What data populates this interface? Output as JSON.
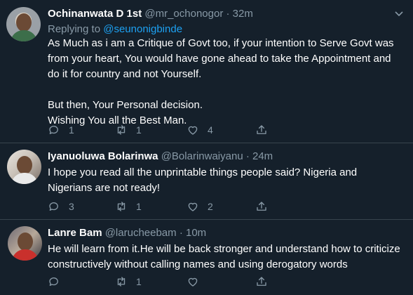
{
  "tweets": [
    {
      "name": "Ochinanwata D 1st",
      "handle": "@mr_ochonogor",
      "dot": "·",
      "time": "32m",
      "replying_prefix": "Replying to ",
      "replying_to": "@seunonigbinde",
      "lines": [
        "As Much as i am a Critique of Govt too, if your intention to Serve Govt was",
        "from your heart, You would have gone ahead to take the Appointment and",
        "do it for country and not Yourself.",
        "",
        "But then, Your Personal decision.",
        "Wishing You all the Best Man."
      ],
      "replies": "1",
      "retweets": "1",
      "likes": "4"
    },
    {
      "name": "Iyanuoluwa Bolarinwa",
      "handle": "@Bolarinwaiyanu",
      "dot": "·",
      "time": "24m",
      "lines": [
        "I hope you read all the unprintable things people said? Nigeria and",
        "Nigerians are not ready!"
      ],
      "replies": "3",
      "retweets": "1",
      "likes": "2"
    },
    {
      "name": "Lanre Bam",
      "handle": "@larucheebam",
      "dot": "·",
      "time": "10m",
      "lines": [
        "He will learn from it.He will be back stronger and understand how to criticize",
        "constructively without calling names and using derogatory words"
      ],
      "replies": "",
      "retweets": "1",
      "likes": ""
    }
  ],
  "icons": {
    "reply": "reply-icon",
    "retweet": "retweet-icon",
    "like": "heart-icon",
    "share": "share-icon",
    "more": "chevron-down-icon"
  },
  "colors": {
    "background": "#15202b",
    "secondary_text": "#8899a6",
    "link": "#1da1f2",
    "divider": "#38444d"
  }
}
